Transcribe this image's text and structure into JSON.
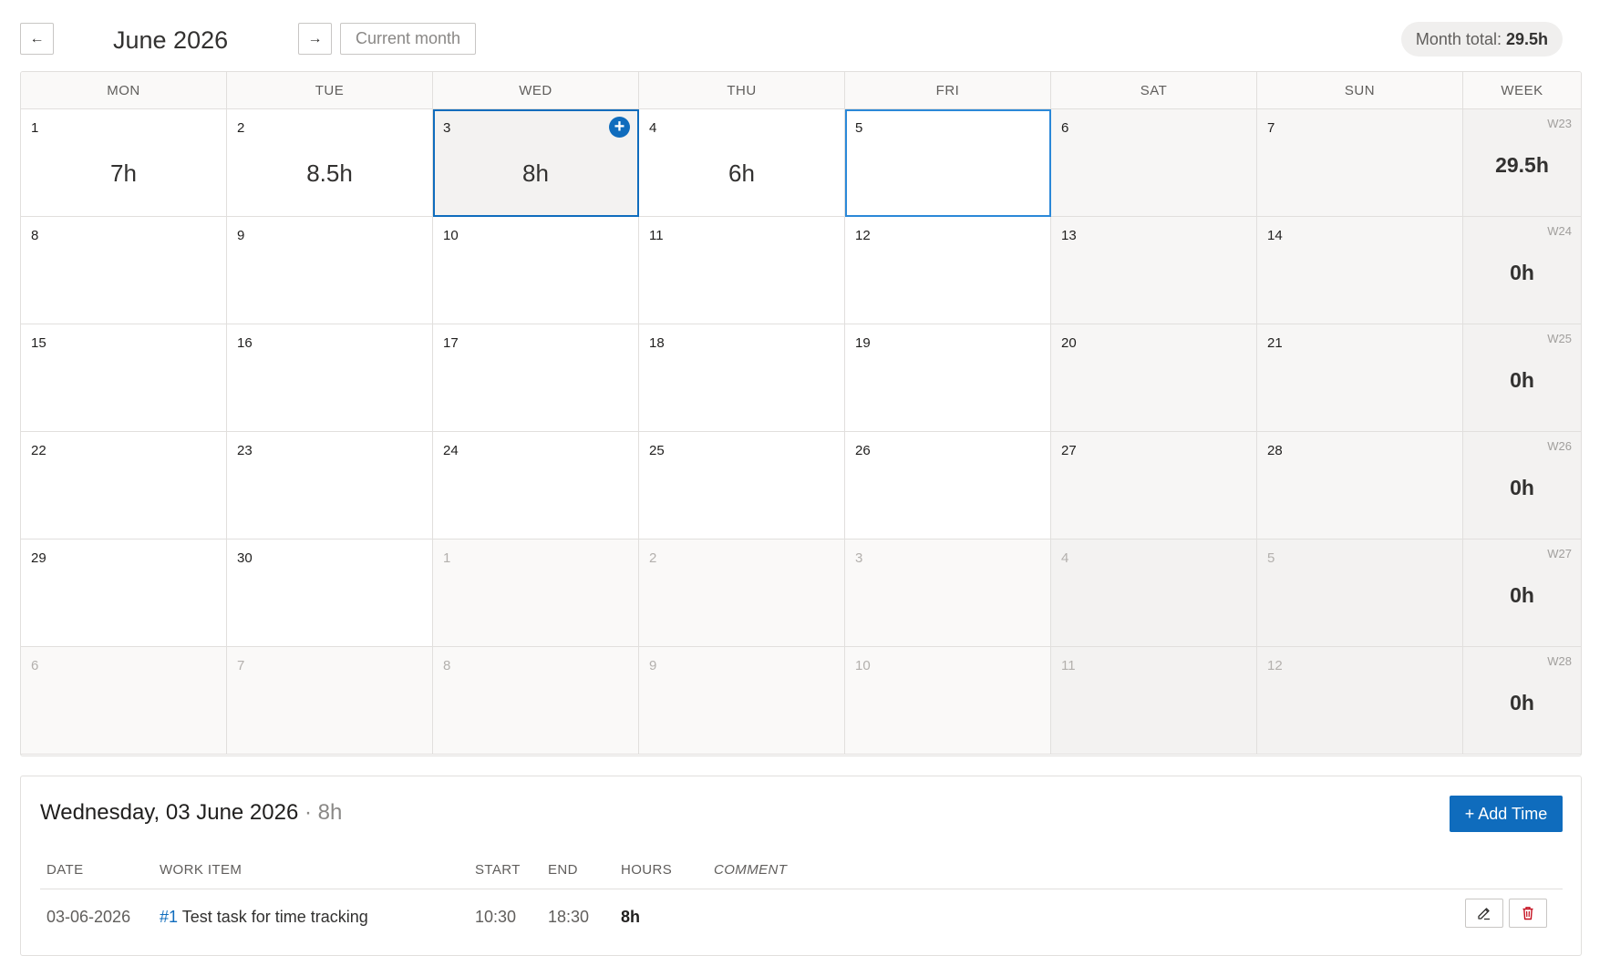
{
  "header": {
    "prev_label": "←",
    "next_label": "→",
    "title": "June 2026",
    "current_label": "Current month",
    "total_label": "Month total:",
    "total_value": "29.5h"
  },
  "calendar": {
    "day_headers": [
      "MON",
      "TUE",
      "WED",
      "THU",
      "FRI",
      "SAT",
      "SUN"
    ],
    "week_header": "WEEK",
    "weeks": [
      {
        "label": "W23",
        "total": "29.5h",
        "days": [
          {
            "num": "1",
            "hours": "7h"
          },
          {
            "num": "2",
            "hours": "8.5h"
          },
          {
            "num": "3",
            "hours": "8h",
            "selected": true
          },
          {
            "num": "4",
            "hours": "6h"
          },
          {
            "num": "5",
            "hours": "",
            "today": true
          },
          {
            "num": "6",
            "hours": ""
          },
          {
            "num": "7",
            "hours": ""
          }
        ]
      },
      {
        "label": "W24",
        "total": "0h",
        "days": [
          {
            "num": "8"
          },
          {
            "num": "9"
          },
          {
            "num": "10"
          },
          {
            "num": "11"
          },
          {
            "num": "12"
          },
          {
            "num": "13"
          },
          {
            "num": "14"
          }
        ]
      },
      {
        "label": "W25",
        "total": "0h",
        "days": [
          {
            "num": "15"
          },
          {
            "num": "16"
          },
          {
            "num": "17"
          },
          {
            "num": "18"
          },
          {
            "num": "19"
          },
          {
            "num": "20"
          },
          {
            "num": "21"
          }
        ]
      },
      {
        "label": "W26",
        "total": "0h",
        "days": [
          {
            "num": "22"
          },
          {
            "num": "23"
          },
          {
            "num": "24"
          },
          {
            "num": "25"
          },
          {
            "num": "26"
          },
          {
            "num": "27"
          },
          {
            "num": "28"
          }
        ]
      },
      {
        "label": "W27",
        "total": "0h",
        "days": [
          {
            "num": "29"
          },
          {
            "num": "30"
          },
          {
            "num": "1",
            "other": true
          },
          {
            "num": "2",
            "other": true
          },
          {
            "num": "3",
            "other": true
          },
          {
            "num": "4",
            "other": true
          },
          {
            "num": "5",
            "other": true
          }
        ]
      },
      {
        "label": "W28",
        "total": "0h",
        "days": [
          {
            "num": "6",
            "other": true
          },
          {
            "num": "7",
            "other": true
          },
          {
            "num": "8",
            "other": true
          },
          {
            "num": "9",
            "other": true
          },
          {
            "num": "10",
            "other": true
          },
          {
            "num": "11",
            "other": true
          },
          {
            "num": "12",
            "other": true
          }
        ]
      }
    ]
  },
  "detail": {
    "title": "Wednesday, 03 June 2026",
    "separator": "·",
    "hours": "8h",
    "add_time_label": "+ Add Time",
    "columns": {
      "date": "DATE",
      "work_item": "WORK ITEM",
      "start": "START",
      "end": "END",
      "hours": "HOURS",
      "comment": "COMMENT"
    },
    "rows": [
      {
        "date": "03-06-2026",
        "item_id": "#1",
        "item_title": "Test task for time tracking",
        "start": "10:30",
        "end": "18:30",
        "hours": "8h",
        "comment": ""
      }
    ]
  },
  "colors": {
    "accent": "#0f6cbd",
    "today_border": "#2b88d8",
    "delete_icon": "#c50f1f"
  },
  "icons": {
    "prev": "arrow-left-icon",
    "next": "arrow-right-icon",
    "add_day": "plus-circle-icon",
    "edit": "pencil-icon",
    "delete": "trash-icon"
  }
}
